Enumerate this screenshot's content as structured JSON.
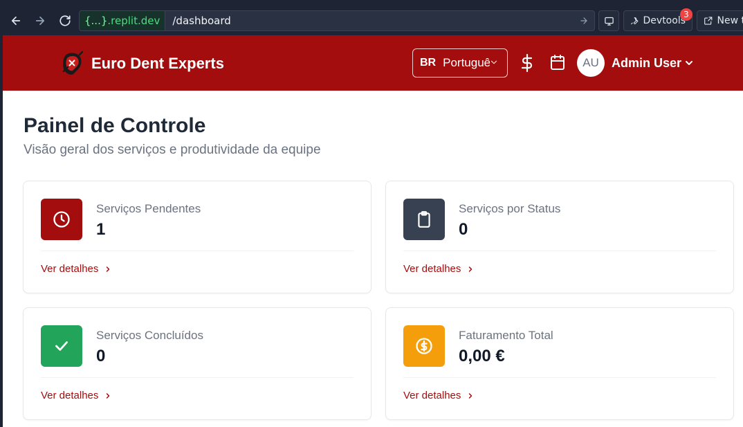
{
  "browser": {
    "url_host_prefix": "{...}",
    "url_host": ".replit.dev",
    "url_path": "/dashboard",
    "devtools_label": "Devtools",
    "devtools_badge": "3",
    "new_tab_label": "New t"
  },
  "header": {
    "brand": "Euro Dent Experts",
    "language_code": "BR",
    "language_label": "Português",
    "avatar_initials": "AU",
    "user_name": "Admin User"
  },
  "page": {
    "title": "Painel de Controle",
    "subtitle": "Visão geral dos serviços e produtividade da equipe"
  },
  "cards": [
    {
      "label": "Serviços Pendentes",
      "value": "1",
      "link": "Ver detalhes",
      "icon": "clock-icon",
      "color": "#a30d0d"
    },
    {
      "label": "Serviços por Status",
      "value": "0",
      "link": "Ver detalhes",
      "icon": "clipboard-icon",
      "color": "#374151"
    },
    {
      "label": "Serviços Concluídos",
      "value": "0",
      "link": "Ver detalhes",
      "icon": "check-icon",
      "color": "#22a55a"
    },
    {
      "label": "Faturamento Total",
      "value": "0,00 €",
      "link": "Ver detalhes",
      "icon": "dollar-circle-icon",
      "color": "#f59e0b"
    }
  ]
}
